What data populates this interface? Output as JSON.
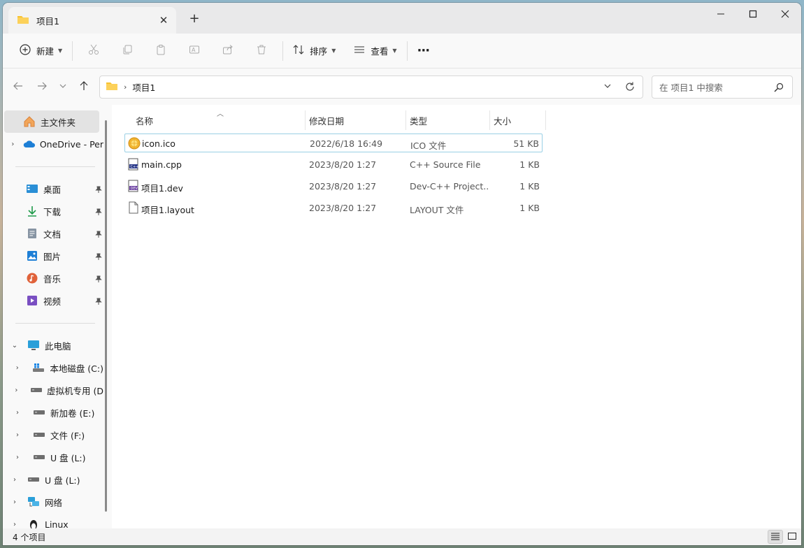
{
  "window": {
    "tab_title": "项目1",
    "newtab_label": "+",
    "close_glyph": "✕"
  },
  "toolbar": {
    "new_label": "新建",
    "sort_label": "排序",
    "view_label": "查看",
    "more_label": "···"
  },
  "address": {
    "path": "项目1",
    "search_placeholder": "在 项目1 中搜索"
  },
  "sidebar": {
    "home": "主文件夹",
    "onedrive": "OneDrive - Per",
    "quick": [
      "桌面",
      "下载",
      "文档",
      "图片",
      "音乐",
      "视频"
    ],
    "this_pc": "此电脑",
    "drives": [
      "本地磁盘 (C:)",
      "虚拟机专用 (D",
      "新加卷 (E:)",
      "文件 (F:)",
      "U 盘 (L:)"
    ],
    "usb": "U 盘 (L:)",
    "network": "网络",
    "linux": "Linux"
  },
  "columns": {
    "name": "名称",
    "date": "修改日期",
    "type": "类型",
    "size": "大小"
  },
  "files": [
    {
      "name": "icon.ico",
      "date": "2022/6/18 16:49",
      "type": "ICO 文件",
      "size": "51 KB"
    },
    {
      "name": "main.cpp",
      "date": "2023/8/20 1:27",
      "type": "C++ Source File",
      "size": "1 KB"
    },
    {
      "name": "项目1.dev",
      "date": "2023/8/20 1:27",
      "type": "Dev-C++ Project...",
      "size": "1 KB"
    },
    {
      "name": "项目1.layout",
      "date": "2023/8/20 1:27",
      "type": "LAYOUT 文件",
      "size": "1 KB"
    }
  ],
  "status": {
    "count": "4 个项目"
  },
  "colors": {
    "accent": "#0067c0",
    "folder": "#f8c22e",
    "selection_border": "#9ad0e5"
  }
}
